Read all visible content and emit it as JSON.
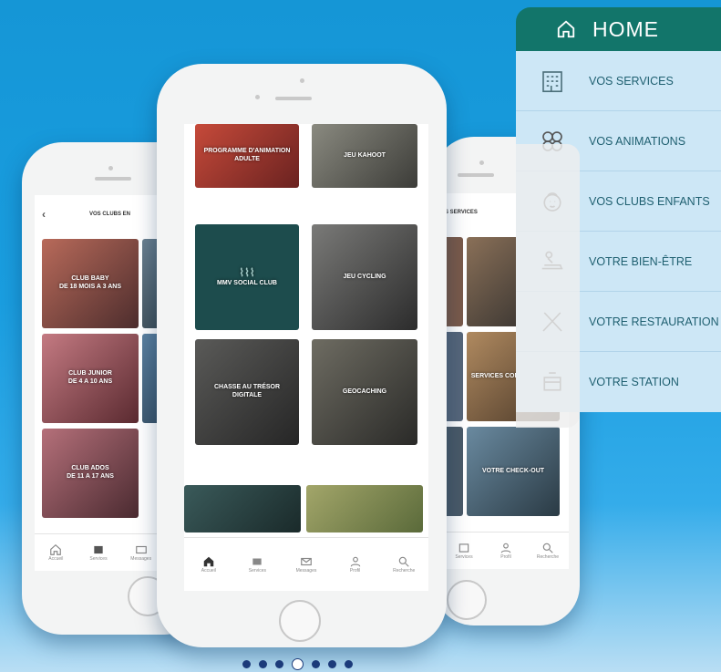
{
  "left_phone": {
    "header_title": "VOS CLUBS EN",
    "back_glyph": "‹",
    "tiles": [
      {
        "label": "CLUB BABY\nDE 18 MOIS A 3 ANS",
        "color": "#7a4a48"
      },
      {
        "label": "CLUB JUNIOR\nDE 4 A 10 ANS",
        "color": "#8c5a5c"
      },
      {
        "label": "CLUB ADOS\nDE 11 A 17 ANS",
        "color": "#884b4e"
      }
    ],
    "tabs": [
      {
        "icon": "home-icon",
        "label": "Accueil"
      },
      {
        "icon": "services-icon",
        "label": "Services"
      },
      {
        "icon": "mail-icon",
        "label": "Messages"
      }
    ]
  },
  "center_phone": {
    "tiles": [
      {
        "label": "PROGRAMME D'ANIMATION ADULTE",
        "color": "#8b2f2a"
      },
      {
        "label": "JEU KAHOOT",
        "color": "#6b6a66"
      },
      {
        "label": "MMV SOCIAL CLUB",
        "color": "#1c4b4d"
      },
      {
        "label": "JEU CYCLING",
        "color": "#4b4b4b"
      },
      {
        "label": "CHASSE AU TRÉSOR DIGITALE",
        "color": "#3c3c3c"
      },
      {
        "label": "GEOCACHING",
        "color": "#4a4a46"
      }
    ],
    "logo_text": "MMV",
    "tabs": [
      {
        "icon": "home-icon",
        "label": "Accueil"
      },
      {
        "icon": "services-icon",
        "label": "Services"
      },
      {
        "icon": "mail-icon",
        "label": "Messages"
      },
      {
        "icon": "profile-icon",
        "label": "Profil"
      },
      {
        "icon": "search-icon",
        "label": "Recherche"
      }
    ]
  },
  "right_phone": {
    "header_title": "S SERVICES",
    "tiles": [
      {
        "label": "SERVICES CONFORT PLUS",
        "color": "#6e4a36"
      },
      {
        "label": "VOTRE CHECK-OUT",
        "color": "#3e4e56"
      }
    ],
    "tabs": [
      {
        "icon": "services-icon",
        "label": "Services"
      },
      {
        "icon": "profile-icon",
        "label": "Profil"
      },
      {
        "icon": "search-icon",
        "label": "Recherche"
      }
    ]
  },
  "menu": {
    "header_label": "HOME",
    "header_icon": "home-icon",
    "items": [
      {
        "label": "VOS SERVICES",
        "icon": "hotel-icon"
      },
      {
        "label": "VOS ANIMATIONS",
        "icon": "animations-icon"
      },
      {
        "label": "VOS CLUBS ENFANTS",
        "icon": "child-icon"
      },
      {
        "label": "VOTRE BIEN-ÊTRE",
        "icon": "massage-icon"
      },
      {
        "label": "VOTRE RESTAURATION",
        "icon": "cutlery-icon"
      },
      {
        "label": "VOTRE STATION",
        "icon": "station-icon"
      }
    ],
    "accent": "#12756a"
  },
  "carousel": {
    "count": 7,
    "active_index": 3
  }
}
